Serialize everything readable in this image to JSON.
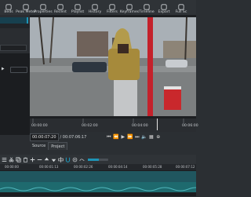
{
  "toolbar": {
    "items": [
      {
        "label": "Beds",
        "icon": "beds-icon"
      },
      {
        "label": "Peak Meter",
        "icon": "peak-meter-icon"
      },
      {
        "label": "Properties",
        "icon": "properties-icon"
      },
      {
        "label": "Recent",
        "icon": "recent-icon"
      },
      {
        "label": "Playlist",
        "icon": "playlist-icon"
      },
      {
        "label": "History",
        "icon": "history-icon"
      },
      {
        "label": "Filters",
        "icon": "filters-icon"
      },
      {
        "label": "Keyframes",
        "icon": "keyframes-icon"
      },
      {
        "label": "Timeline",
        "icon": "timeline-icon"
      },
      {
        "label": "Export",
        "icon": "export-icon"
      },
      {
        "label": "Full Sc",
        "icon": "fullscreen-icon"
      }
    ]
  },
  "ruler": {
    "labels": [
      "00:00:00",
      "00:02:00",
      "00:04:00",
      "00:06:00"
    ]
  },
  "transport": {
    "current_time": "00:00:07:20",
    "total_time": "/ 00:07:06:17",
    "playhead_fraction": 0.77
  },
  "source_tabs": {
    "source": "Source",
    "project": "Project"
  },
  "timeline": {
    "ruler_labels": [
      "00:00:00",
      "00:00:01:13",
      "00:00:02:26",
      "00:00:04:14",
      "00:00:05:28",
      "00:00:07:12"
    ],
    "zoom_fraction": 0.55
  },
  "colors": {
    "accent": "#1e94b6",
    "clip": "#20565f",
    "audio": "#1e6a6e"
  }
}
